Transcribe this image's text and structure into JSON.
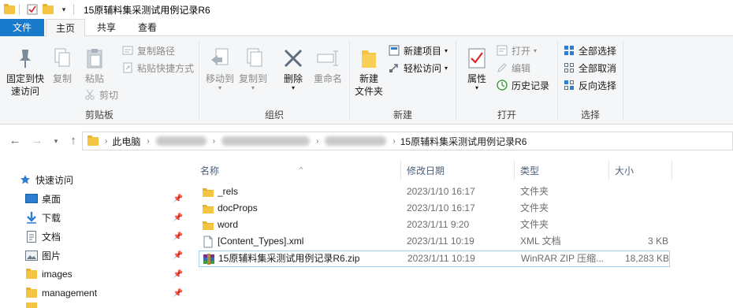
{
  "window": {
    "title": "15原辅料集采测试用例记录R6"
  },
  "tabs": [
    "文件",
    "主页",
    "共享",
    "查看"
  ],
  "ribbon": {
    "clipboard": {
      "pin_label_line1": "固定到快",
      "pin_label_line2": "速访问",
      "copy": "复制",
      "paste": "粘贴",
      "copy_path": "复制路径",
      "paste_shortcut": "粘贴快捷方式",
      "cut": "剪切",
      "group": "剪贴板"
    },
    "organize": {
      "move_to": "移动到",
      "copy_to": "复制到",
      "delete": "删除",
      "rename": "重命名",
      "group": "组织"
    },
    "new": {
      "new_folder_line1": "新建",
      "new_folder_line2": "文件夹",
      "new_item": "新建项目",
      "easy_access": "轻松访问",
      "group": "新建"
    },
    "open": {
      "properties": "属性",
      "open": "打开",
      "edit": "编辑",
      "history": "历史记录",
      "group": "打开"
    },
    "select": {
      "select_all": "全部选择",
      "select_none": "全部取消",
      "invert": "反向选择",
      "group": "选择"
    }
  },
  "address": {
    "root": "此电脑",
    "current": "15原辅料集采测试用例记录R6"
  },
  "nav": {
    "quick_access": "快速访问",
    "items": [
      {
        "label": "桌面",
        "icon": "desktop-icon"
      },
      {
        "label": "下载",
        "icon": "download-icon"
      },
      {
        "label": "文档",
        "icon": "document-icon"
      },
      {
        "label": "图片",
        "icon": "pictures-icon"
      },
      {
        "label": "images",
        "icon": "folder-icon"
      },
      {
        "label": "management",
        "icon": "folder-icon"
      }
    ]
  },
  "columns": {
    "name": "名称",
    "date": "修改日期",
    "type": "类型",
    "size": "大小"
  },
  "files": [
    {
      "name": "_rels",
      "date": "2023/1/10 16:17",
      "type": "文件夹",
      "size": "",
      "icon": "folder-icon"
    },
    {
      "name": "docProps",
      "date": "2023/1/10 16:17",
      "type": "文件夹",
      "size": "",
      "icon": "folder-icon"
    },
    {
      "name": "word",
      "date": "2023/1/11 9:20",
      "type": "文件夹",
      "size": "",
      "icon": "folder-icon"
    },
    {
      "name": "[Content_Types].xml",
      "date": "2023/1/11 10:19",
      "type": "XML 文档",
      "size": "3 KB",
      "icon": "xml-file-icon"
    },
    {
      "name": "15原辅料集采测试用例记录R6.zip",
      "date": "2023/1/11 10:19",
      "type": "WinRAR ZIP 压缩...",
      "size": "18,283 KB",
      "icon": "winrar-zip-icon"
    }
  ],
  "colors": {
    "file_tab": "#1979ca",
    "folder": "#f4c542",
    "selection_border": "#99d1ff"
  }
}
